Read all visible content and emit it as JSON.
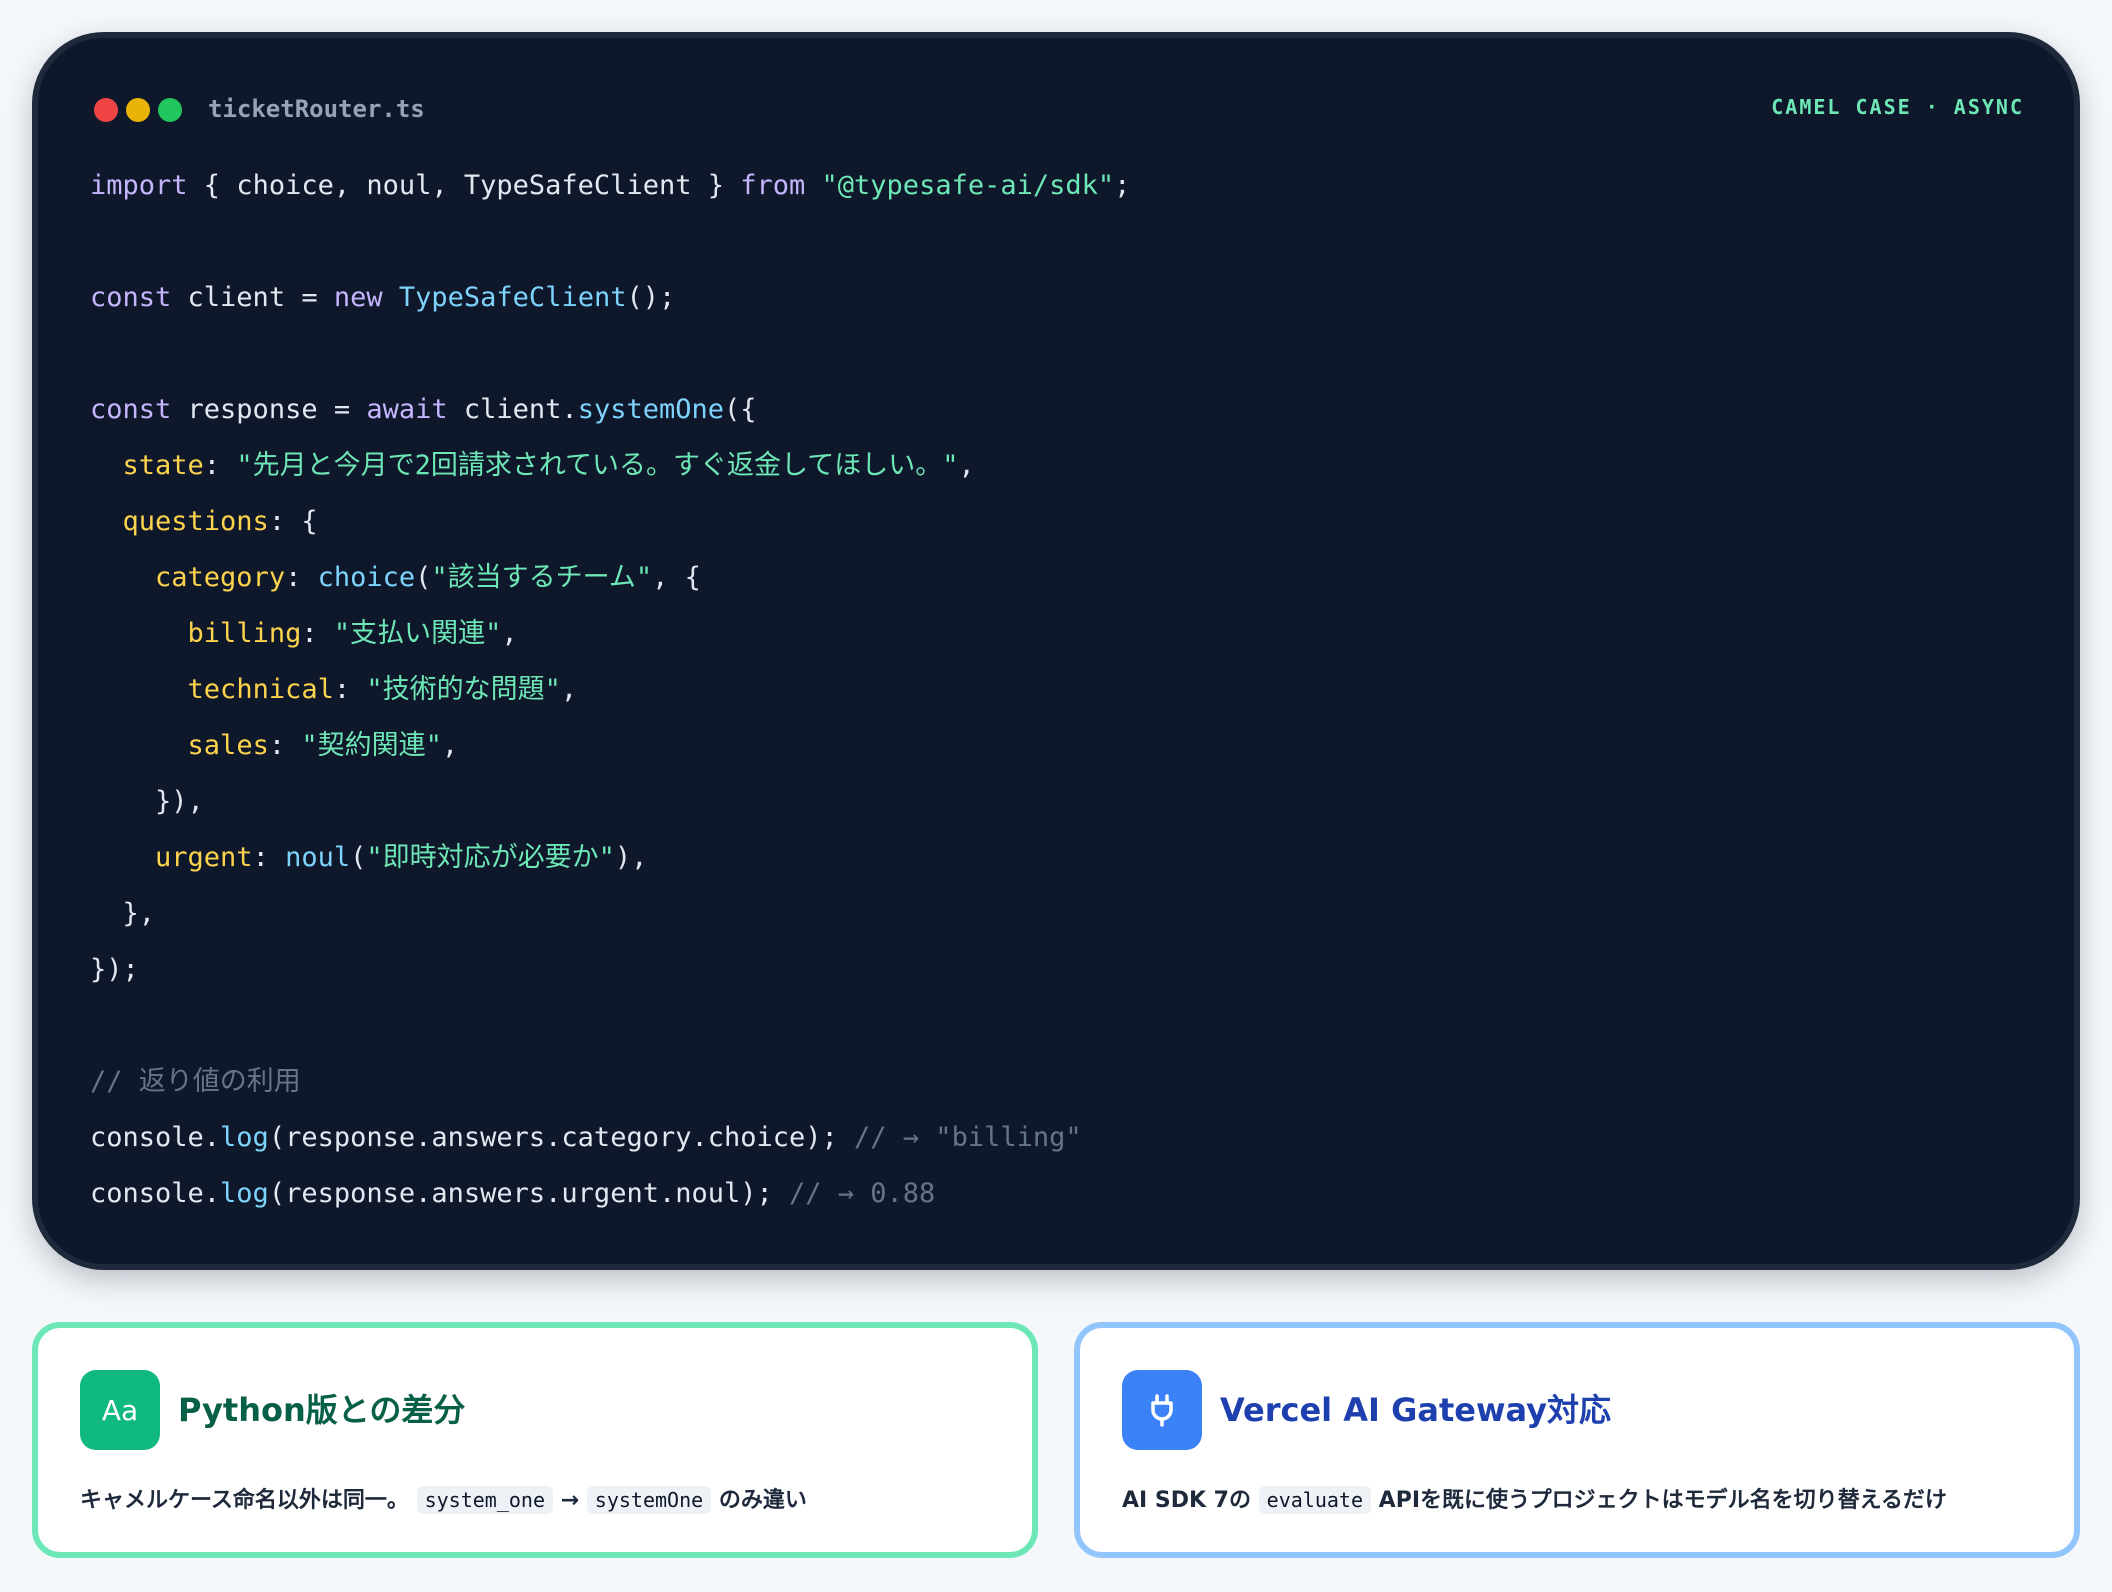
{
  "window": {
    "filename": "ticketRouter.ts",
    "tag": "CAMEL CASE · ASYNC"
  },
  "code": {
    "lines": [
      [
        [
          "kw",
          "import"
        ],
        [
          "p",
          " { choice, noul, TypeSafeClient } "
        ],
        [
          "kw",
          "from"
        ],
        [
          "p",
          " "
        ],
        [
          "str",
          "\"@typesafe-ai/sdk\""
        ],
        [
          "p",
          ";"
        ]
      ],
      [],
      [
        [
          "kw",
          "const"
        ],
        [
          "p",
          " client = "
        ],
        [
          "kw",
          "new"
        ],
        [
          "p",
          " "
        ],
        [
          "fn",
          "TypeSafeClient"
        ],
        [
          "p",
          "();"
        ]
      ],
      [],
      [
        [
          "kw",
          "const"
        ],
        [
          "p",
          " response = "
        ],
        [
          "kw",
          "await"
        ],
        [
          "p",
          " client."
        ],
        [
          "fn",
          "systemOne"
        ],
        [
          "p",
          "({"
        ]
      ],
      [
        [
          "p",
          "  "
        ],
        [
          "prop",
          "state"
        ],
        [
          "p",
          ": "
        ],
        [
          "str",
          "\"先月と今月で2回請求されている。すぐ返金してほしい。\""
        ],
        [
          "p",
          ","
        ]
      ],
      [
        [
          "p",
          "  "
        ],
        [
          "prop",
          "questions"
        ],
        [
          "p",
          ": {"
        ]
      ],
      [
        [
          "p",
          "    "
        ],
        [
          "prop",
          "category"
        ],
        [
          "p",
          ": "
        ],
        [
          "fn",
          "choice"
        ],
        [
          "p",
          "("
        ],
        [
          "str",
          "\"該当するチーム\""
        ],
        [
          "p",
          ", {"
        ]
      ],
      [
        [
          "p",
          "      "
        ],
        [
          "prop",
          "billing"
        ],
        [
          "p",
          ": "
        ],
        [
          "str",
          "\"支払い関連\""
        ],
        [
          "p",
          ","
        ]
      ],
      [
        [
          "p",
          "      "
        ],
        [
          "prop",
          "technical"
        ],
        [
          "p",
          ": "
        ],
        [
          "str",
          "\"技術的な問題\""
        ],
        [
          "p",
          ","
        ]
      ],
      [
        [
          "p",
          "      "
        ],
        [
          "prop",
          "sales"
        ],
        [
          "p",
          ": "
        ],
        [
          "str",
          "\"契約関連\""
        ],
        [
          "p",
          ","
        ]
      ],
      [
        [
          "p",
          "    }),"
        ]
      ],
      [
        [
          "p",
          "    "
        ],
        [
          "prop",
          "urgent"
        ],
        [
          "p",
          ": "
        ],
        [
          "fn",
          "noul"
        ],
        [
          "p",
          "("
        ],
        [
          "str",
          "\"即時対応が必要か\""
        ],
        [
          "p",
          "),"
        ]
      ],
      [
        [
          "p",
          "  },"
        ]
      ],
      [
        [
          "p",
          "});"
        ]
      ],
      [],
      [
        [
          "cm",
          "// 返り値の利用"
        ]
      ],
      [
        [
          "p",
          "console."
        ],
        [
          "fn",
          "log"
        ],
        [
          "p",
          "(response.answers.category.choice); "
        ],
        [
          "cm",
          "// → \"billing\""
        ]
      ],
      [
        [
          "p",
          "console."
        ],
        [
          "fn",
          "log"
        ],
        [
          "p",
          "(response.answers.urgent.noul); "
        ],
        [
          "cm",
          "// → 0.88"
        ]
      ]
    ]
  },
  "cards": [
    {
      "icon": "text-aa-icon",
      "badge_text": "Aa",
      "title": "Python版との差分",
      "desc_pre": "キャメルケース命名以外は同一。",
      "code1": "system_one",
      "arrow": "→",
      "code2": "systemOne",
      "desc_post": "のみ違い",
      "accent": "#10b981"
    },
    {
      "icon": "plug-icon",
      "title": "Vercel AI Gateway対応",
      "desc_pre": "AI SDK 7の",
      "code1": "evaluate",
      "desc_post": "APIを既に使うプロジェクトはモデル名を切り替えるだけ",
      "accent": "#3b82f6"
    }
  ]
}
